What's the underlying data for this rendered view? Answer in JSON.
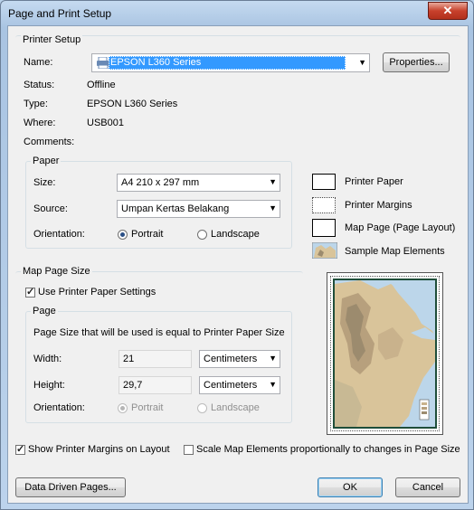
{
  "window": {
    "title": "Page and Print Setup",
    "close_glyph": "✕"
  },
  "printer_setup": {
    "group_label": "Printer Setup",
    "name_label": "Name:",
    "printer_name": "EPSON L360 Series",
    "properties_label": "Properties...",
    "status_label": "Status:",
    "status_value": "Offline",
    "type_label": "Type:",
    "type_value": "EPSON L360 Series",
    "where_label": "Where:",
    "where_value": "USB001",
    "comments_label": "Comments:"
  },
  "paper": {
    "group_label": "Paper",
    "size_label": "Size:",
    "size_value": "A4 210 x 297 mm",
    "source_label": "Source:",
    "source_value": "Umpan Kertas Belakang",
    "orientation_label": "Orientation:",
    "portrait_label": "Portrait",
    "landscape_label": "Landscape",
    "orientation_selected": "Portrait"
  },
  "legend": {
    "printer_paper": "Printer Paper",
    "printer_margins": "Printer Margins",
    "map_page": "Map Page (Page Layout)",
    "sample_map": "Sample Map Elements"
  },
  "map_page_size": {
    "group_label": "Map Page Size",
    "use_printer_label": "Use Printer Paper Settings",
    "use_printer_checked": true,
    "page_group_label": "Page",
    "info_text": "Page Size that will be used is equal to Printer Paper Size",
    "width_label": "Width:",
    "width_value": "21",
    "width_unit": "Centimeters",
    "height_label": "Height:",
    "height_value": "29,7",
    "height_unit": "Centimeters",
    "orientation_label": "Orientation:",
    "portrait_label": "Portrait",
    "landscape_label": "Landscape"
  },
  "options": {
    "show_margins_label": "Show Printer Margins on Layout",
    "show_margins_checked": true,
    "scale_label": "Scale Map Elements proportionally to changes in Page Size",
    "scale_checked": false
  },
  "buttons": {
    "data_driven": "Data Driven Pages...",
    "ok": "OK",
    "cancel": "Cancel"
  },
  "colors": {
    "selection": "#3399ff",
    "sea": "#bcd6ea",
    "land": "#d9c49a"
  }
}
